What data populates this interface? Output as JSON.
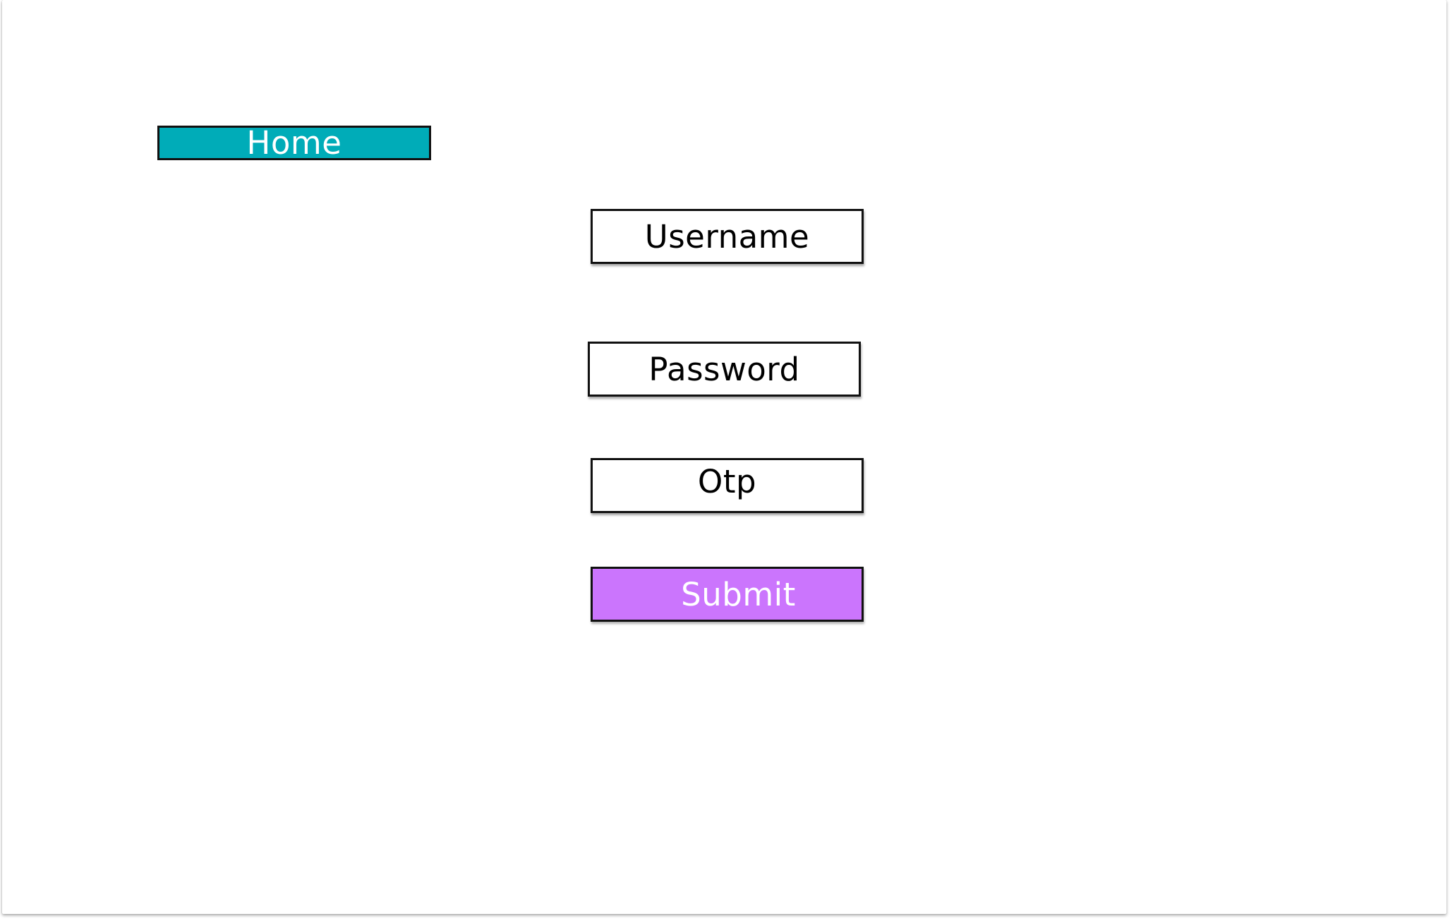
{
  "colors": {
    "home_button_bg": "#00acb8",
    "submit_button_bg": "#cb75fd",
    "border": "#111111"
  },
  "nav": {
    "home_label": "Home"
  },
  "form": {
    "username_placeholder": "Username",
    "password_placeholder": "Password",
    "otp_placeholder": "Otp",
    "submit_label": "Submit"
  }
}
